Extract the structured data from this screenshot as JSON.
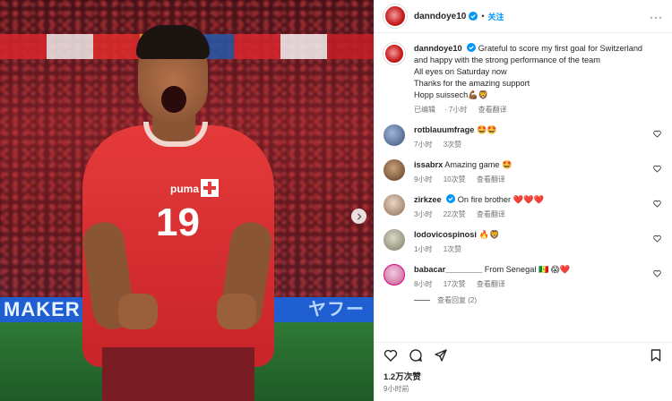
{
  "post": {
    "username": "danndoye10",
    "follow_label": "关注",
    "more_label": "···",
    "caption_lines": [
      "Grateful to score my first goal for Switzerland",
      "and happy with the strong performance of the team",
      "All eyes on Saturday now",
      "Thanks for the amazing support",
      "Hopp suissech💪🏾🦁"
    ],
    "caption_meta": {
      "edited": "已编辑",
      "time": "7小时",
      "translate": "查看翻译"
    },
    "likes": "1.2万次赞",
    "posted_time": "9小时前",
    "view_replies": "查看回复 (2)",
    "media": {
      "ad_text_left": "MAKER",
      "ad_text_right": "ヤフー",
      "jersey_number": "19",
      "jersey_brand": "puma"
    }
  },
  "comments": [
    {
      "username": "rotblauumfrage",
      "text": "🤩🤩",
      "time": "7小时",
      "likes": "3次赞",
      "translate": "",
      "verified": false
    },
    {
      "username": "issabrx",
      "text": "Amazing game 🤩",
      "time": "9小时",
      "likes": "10次赞",
      "translate": "查看翻译",
      "verified": false
    },
    {
      "username": "zirkzee",
      "text": "On fire brother ❤️❤️❤️",
      "time": "3小时",
      "likes": "22次赞",
      "translate": "查看翻译",
      "verified": true
    },
    {
      "username": "lodovicospinosi",
      "text": "🔥🦁",
      "time": "1小时",
      "likes": "1次赞",
      "translate": "",
      "verified": false
    },
    {
      "username": "babacar________",
      "text": "From Senegal 🇸🇳 😱❤️",
      "time": "8小时",
      "likes": "17次赞",
      "translate": "查看翻译",
      "verified": false
    }
  ],
  "colors": {
    "accent": "#0095f6",
    "text": "#262626",
    "muted": "#737373",
    "jersey": "#e53a3a"
  },
  "icons": [
    "verified-badge-icon",
    "more-icon",
    "heart-icon",
    "comment-icon",
    "share-icon",
    "bookmark-icon",
    "chevron-right-icon"
  ]
}
